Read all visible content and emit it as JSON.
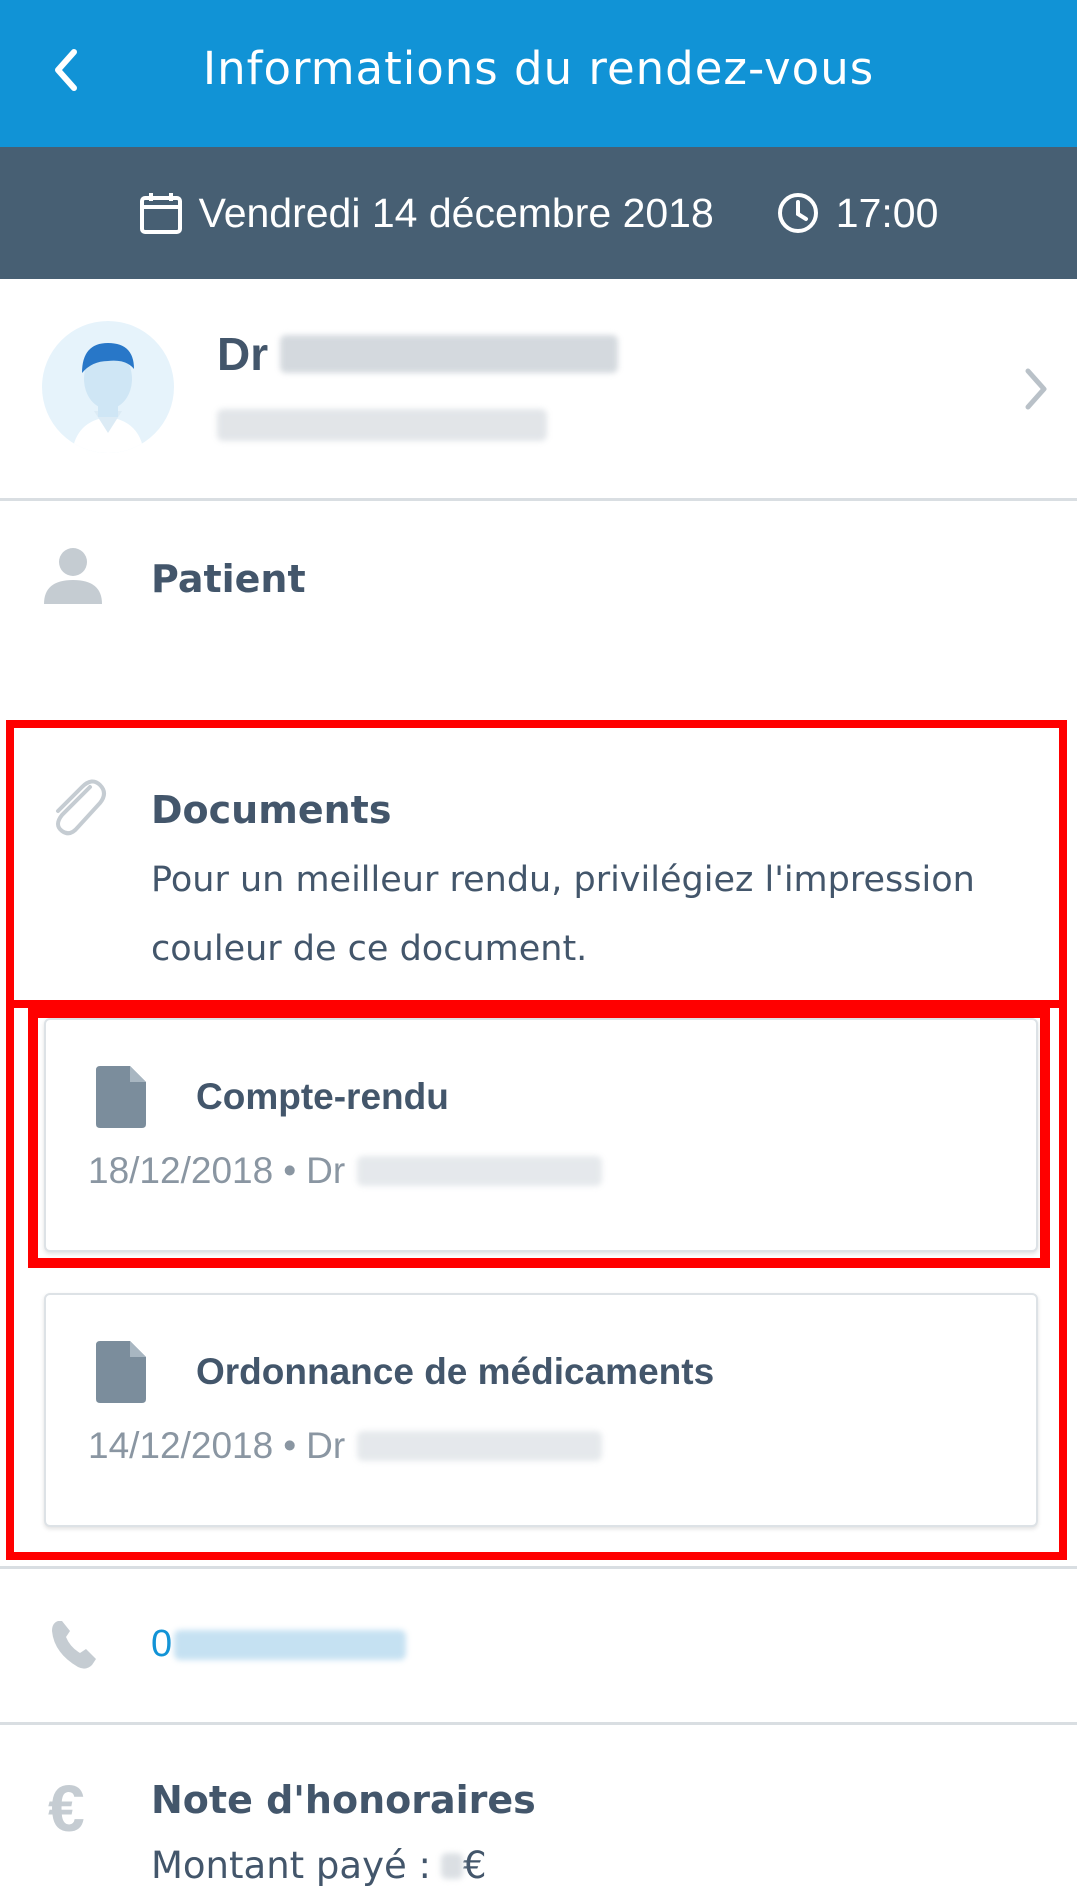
{
  "header": {
    "title": "Informations du rendez-vous",
    "back_icon": "chevron-left-icon"
  },
  "appointment": {
    "date": "Vendredi 14 décembre 2018",
    "time": "17:00"
  },
  "doctor": {
    "prefix": "Dr",
    "name": "[redacted]",
    "specialty": "[redacted]"
  },
  "patient": {
    "label": "Patient"
  },
  "documents": {
    "label": "Documents",
    "note": "Pour un meilleur rendu, privilégiez l'impression couleur de ce document.",
    "items": [
      {
        "title": "Compte-rendu",
        "date": "18/12/2018",
        "sep": "•",
        "author_prefix": "Dr"
      },
      {
        "title": "Ordonnance de médicaments",
        "date": "14/12/2018",
        "sep": "•",
        "author_prefix": "Dr"
      }
    ]
  },
  "phone": {
    "prefix": "0"
  },
  "fees": {
    "label": "Note d'honoraires",
    "paid_label": "Montant payé :",
    "currency": "€"
  },
  "colors": {
    "appbar": "#1193d6",
    "datebar": "#475f73",
    "highlight": "#ff0000",
    "text": "#43566b"
  }
}
